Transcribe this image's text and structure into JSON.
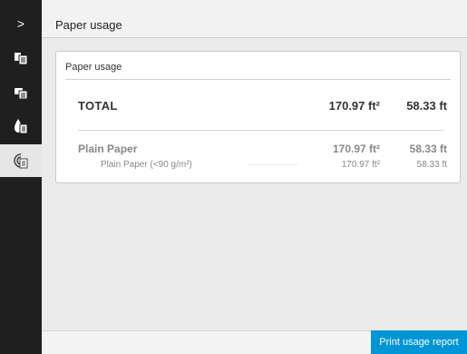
{
  "sidebar": {
    "toggle_glyph": ">",
    "items": [
      {
        "icon": "printer-jobs-icon",
        "active": false
      },
      {
        "icon": "printer-queue-icon",
        "active": false
      },
      {
        "icon": "ink-supplies-icon",
        "active": false
      },
      {
        "icon": "paper-usage-icon",
        "active": true
      }
    ],
    "background": "#1f1f1f",
    "active_background": "#e6e6e6"
  },
  "header": {
    "title": "Paper usage"
  },
  "panel": {
    "title": "Paper usage",
    "total": {
      "label": "TOTAL",
      "area": "170.97 ft²",
      "length": "58.33 ft"
    },
    "rows": [
      {
        "label": "Plain Paper",
        "area": "170.97 ft²",
        "length": "58.33 ft"
      },
      {
        "label": "Plain Paper (<90 g/m²)",
        "area": "170.97 ft²",
        "length": "58.33 ft"
      }
    ]
  },
  "footer": {
    "print_button_label": "Print usage report",
    "accent": "#0096d6"
  }
}
